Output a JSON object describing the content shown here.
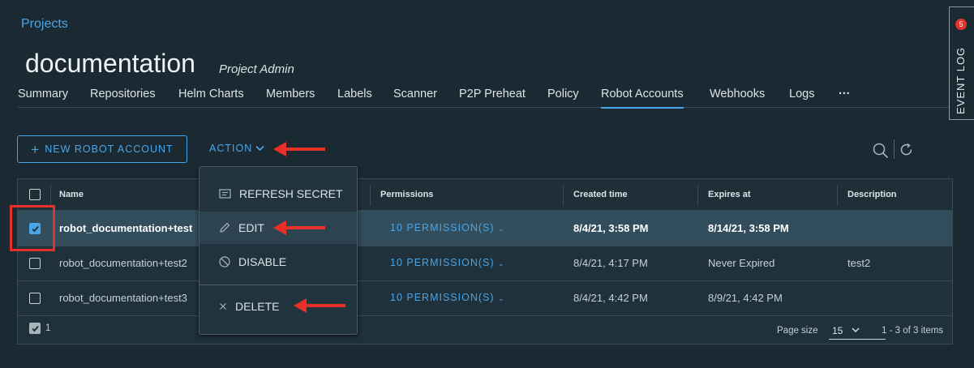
{
  "breadcrumb": "Projects",
  "project": {
    "name": "documentation",
    "role": "Project Admin"
  },
  "tabs": [
    {
      "label": "Summary"
    },
    {
      "label": "Repositories"
    },
    {
      "label": "Helm Charts"
    },
    {
      "label": "Members"
    },
    {
      "label": "Labels"
    },
    {
      "label": "Scanner"
    },
    {
      "label": "P2P Preheat"
    },
    {
      "label": "Policy"
    },
    {
      "label": "Robot Accounts"
    },
    {
      "label": "Webhooks"
    },
    {
      "label": "Logs"
    },
    {
      "label": "···"
    }
  ],
  "active_tab": "Robot Accounts",
  "event_log": {
    "label": "EVENT LOG",
    "count": "5"
  },
  "toolbar": {
    "new_label": "NEW ROBOT ACCOUNT",
    "action_label": "ACTION"
  },
  "table": {
    "columns": [
      "Name",
      "Permissions",
      "Created time",
      "Expires at",
      "Description"
    ],
    "rows": [
      {
        "name": "robot_documentation+test",
        "permissions": "10 PERMISSION(S)",
        "created": "8/4/21, 3:58 PM",
        "expires": "8/14/21, 3:58 PM",
        "description": "",
        "selected": true
      },
      {
        "name": "robot_documentation+test2",
        "permissions": "10 PERMISSION(S)",
        "created": "8/4/21, 4:17 PM",
        "expires": "Never Expired",
        "description": "test2",
        "selected": false
      },
      {
        "name": "robot_documentation+test3",
        "permissions": "10 PERMISSION(S)",
        "created": "8/4/21, 4:42 PM",
        "expires": "8/9/21, 4:42 PM",
        "description": "",
        "selected": false
      }
    ],
    "footer": {
      "selected_count": "1",
      "page_size_label": "Page size",
      "page_size": "15",
      "range": "1 - 3 of 3 items"
    }
  },
  "action_menu": {
    "refresh_secret": "REFRESH SECRET",
    "edit": "EDIT",
    "disable": "DISABLE",
    "delete": "DELETE"
  },
  "colors": {
    "accent": "#4aa5e6",
    "annotation": "#e8302a",
    "background": "#1b2a32"
  }
}
